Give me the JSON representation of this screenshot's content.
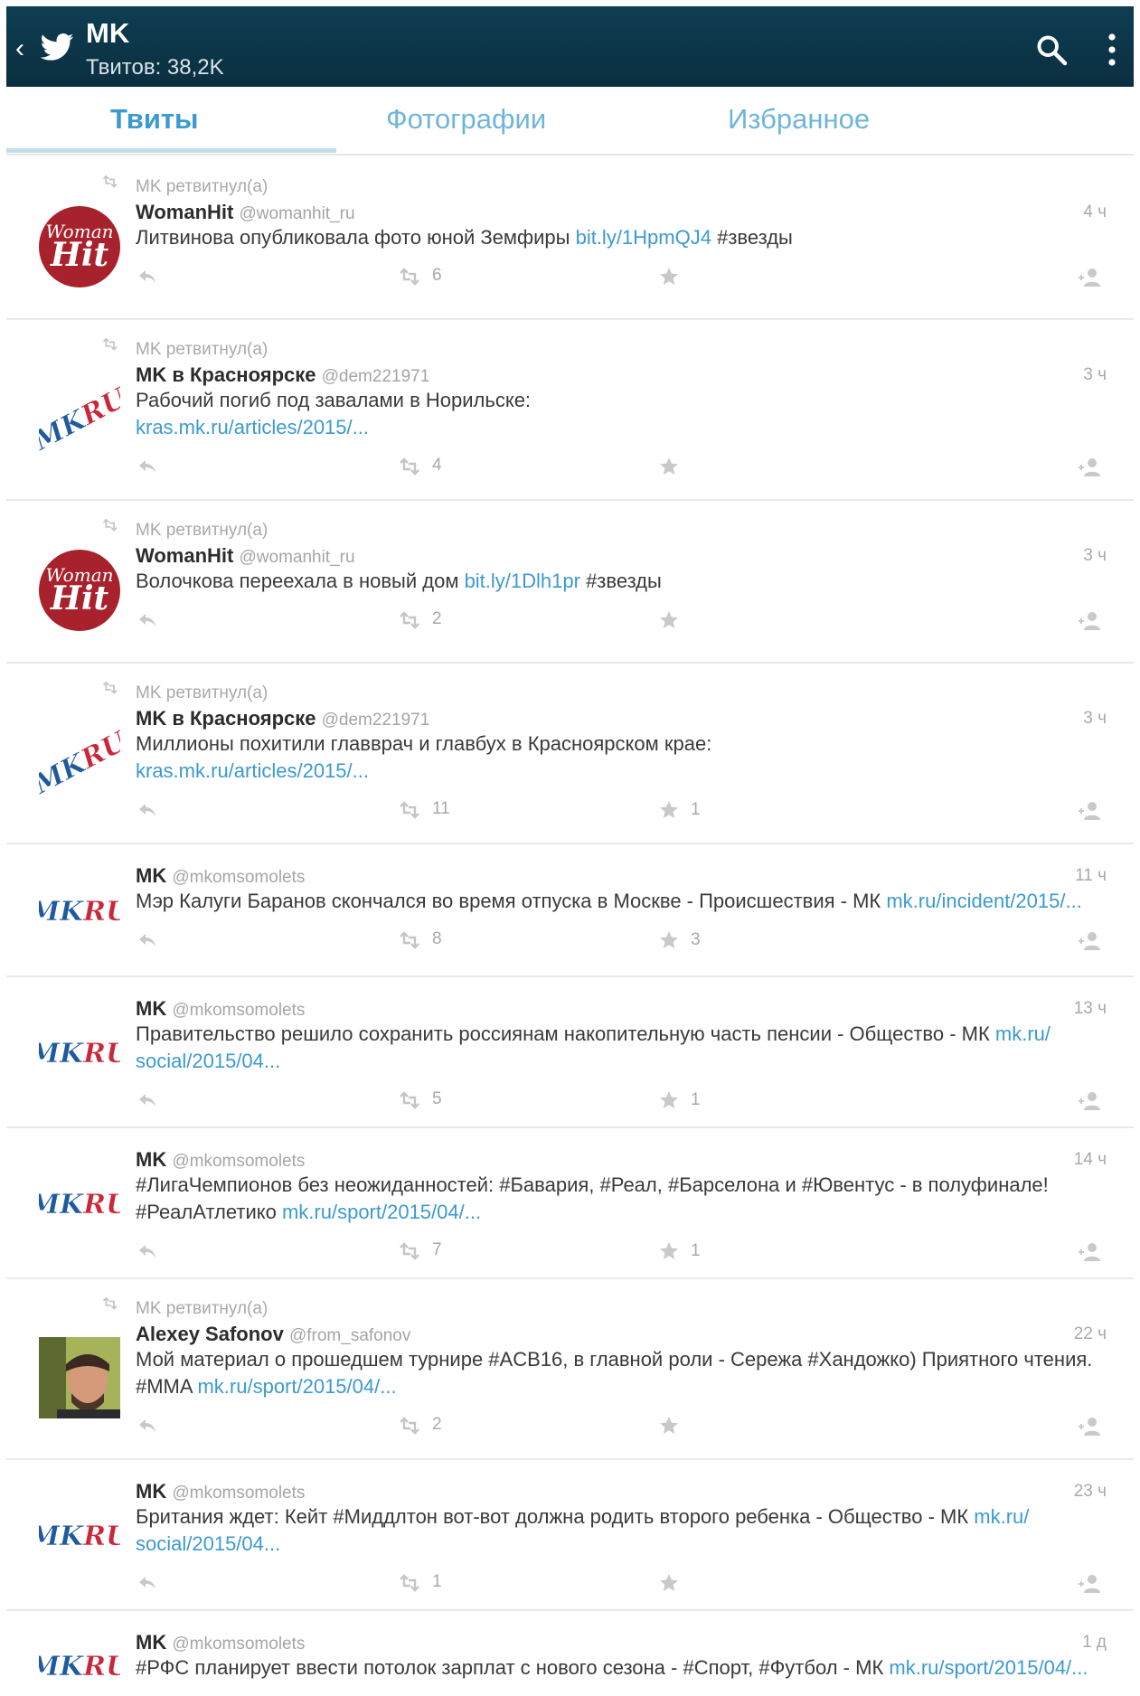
{
  "appbar": {
    "title": "MK",
    "subtitle": "Твитов: 38,2K",
    "back_glyph": "‹",
    "icons": [
      "back-icon",
      "twitter-bird-icon",
      "search-icon",
      "overflow-menu-icon"
    ]
  },
  "tabs": [
    {
      "label": "Твиты",
      "active": true
    },
    {
      "label": "Фотографии",
      "active": false
    },
    {
      "label": "Избранное",
      "active": false
    }
  ],
  "retweet_label": "MK ретвитнул(а)",
  "colors": {
    "appbar": "#0e3d52",
    "accent": "#3b9ad0",
    "tab_inactive": "#6fb5d9",
    "womanhit": "#a8222d"
  },
  "tweets": [
    {
      "retweeted": true,
      "avatar": "womanhit",
      "avatar_text": [
        "Woman",
        "Hit"
      ],
      "name": "WomanHit",
      "handle": "@womanhit_ru",
      "time": "4 ч",
      "text_parts": [
        [
          "Литвинова опубликовала фото юной Земфиры ",
          false
        ],
        [
          "bit.ly/1HpmQJ4",
          true
        ],
        [
          " #звезды",
          false
        ]
      ],
      "retweets": "6",
      "favorites": ""
    },
    {
      "retweeted": true,
      "avatar": "mkru-tilted",
      "avatar_text": [
        "MKRU"
      ],
      "name": "MK в Красноярске",
      "handle": "@dem221971",
      "time": "3 ч",
      "text_parts": [
        [
          "Рабочий погиб под завалами в Норильске:",
          false
        ],
        [
          "\n",
          false
        ],
        [
          "kras.mk.ru/articles/2015/...",
          true
        ]
      ],
      "retweets": "4",
      "favorites": ""
    },
    {
      "retweeted": true,
      "avatar": "womanhit",
      "avatar_text": [
        "Woman",
        "Hit"
      ],
      "name": "WomanHit",
      "handle": "@womanhit_ru",
      "time": "3 ч",
      "text_parts": [
        [
          "Волочкова переехала в новый дом ",
          false
        ],
        [
          "bit.ly/1Dlh1pr",
          true
        ],
        [
          " #звезды",
          false
        ]
      ],
      "retweets": "2",
      "favorites": ""
    },
    {
      "retweeted": true,
      "avatar": "mkru-tilted",
      "avatar_text": [
        "MKRU"
      ],
      "name": "MK в Красноярске",
      "handle": "@dem221971",
      "time": "3 ч",
      "text_parts": [
        [
          "Миллионы похитили главврач и главбух в Красноярском крае:",
          false
        ],
        [
          "\n",
          false
        ],
        [
          "kras.mk.ru/articles/2015/...",
          true
        ]
      ],
      "retweets": "11",
      "favorites": "1"
    },
    {
      "retweeted": false,
      "avatar": "mkru",
      "avatar_text": [
        "MKRU"
      ],
      "name": "MK",
      "handle": "@mkomsomolets",
      "time": "11 ч",
      "text_parts": [
        [
          "Мэр Калуги Баранов скончался во время отпуска в Москве - Происшествия - МК ",
          false
        ],
        [
          "mk.ru/incident/2015/...",
          true
        ]
      ],
      "retweets": "8",
      "favorites": "3"
    },
    {
      "retweeted": false,
      "avatar": "mkru",
      "avatar_text": [
        "MKRU"
      ],
      "name": "MK",
      "handle": "@mkomsomolets",
      "time": "13 ч",
      "text_parts": [
        [
          "Правительство решило сохранить россиянам накопительную часть пенсии - Общество - МК ",
          false
        ],
        [
          "mk.ru/",
          true
        ],
        [
          "\n",
          false
        ],
        [
          "social/2015/04...",
          true
        ]
      ],
      "retweets": "5",
      "favorites": "1"
    },
    {
      "retweeted": false,
      "avatar": "mkru",
      "avatar_text": [
        "MKRU"
      ],
      "name": "MK",
      "handle": "@mkomsomolets",
      "time": "14 ч",
      "text_parts": [
        [
          "#ЛигаЧемпионов без неожиданностей: #Бавария, #Реал, #Барселона и #Ювентус - в полуфинале!",
          false
        ],
        [
          "\n",
          false
        ],
        [
          "#РеалАтлетико ",
          false
        ],
        [
          "mk.ru/sport/2015/04/...",
          true
        ]
      ],
      "retweets": "7",
      "favorites": "1"
    },
    {
      "retweeted": true,
      "avatar": "photo",
      "avatar_text": [],
      "name": "Alexey Safonov",
      "handle": "@from_safonov",
      "time": "22 ч",
      "text_parts": [
        [
          "Мой материал о прошедшем турнире #ACB16, в главной роли - Сережа #Хандожко) Приятного чтения.",
          false
        ],
        [
          "\n",
          false
        ],
        [
          "#MMA ",
          false
        ],
        [
          "mk.ru/sport/2015/04/...",
          true
        ]
      ],
      "retweets": "2",
      "favorites": ""
    },
    {
      "retweeted": false,
      "avatar": "mkru",
      "avatar_text": [
        "MKRU"
      ],
      "name": "MK",
      "handle": "@mkomsomolets",
      "time": "23 ч",
      "text_parts": [
        [
          "Британия ждет: Кейт #Миддлтон вот-вот должна родить второго ребенка - Общество - МК ",
          false
        ],
        [
          "mk.ru/",
          true
        ],
        [
          "\n",
          false
        ],
        [
          "social/2015/04...",
          true
        ]
      ],
      "retweets": "1",
      "favorites": ""
    },
    {
      "retweeted": false,
      "avatar": "mkru",
      "avatar_text": [
        "MKRU"
      ],
      "name": "MK",
      "handle": "@mkomsomolets",
      "time": "1 д",
      "text_parts": [
        [
          "#РФС планирует ввести потолок зарплат с нового сезона - #Спорт, #Футбол - МК ",
          false
        ],
        [
          "mk.ru/sport/2015/04/...",
          true
        ]
      ],
      "retweets": "",
      "favorites": ""
    }
  ]
}
